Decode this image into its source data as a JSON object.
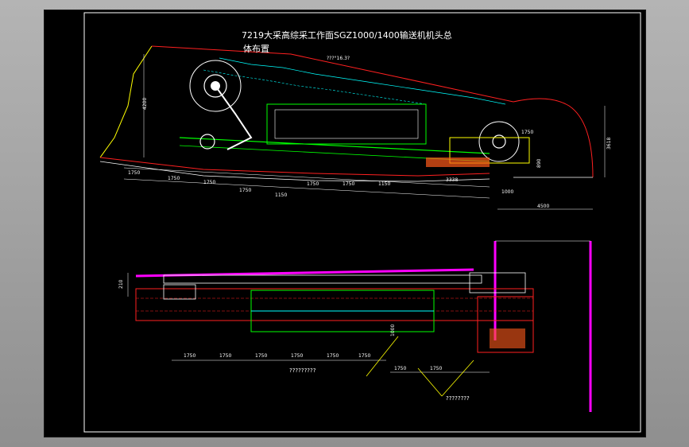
{
  "drawing": {
    "title": "7219大采高综采工作面SGZ1000/1400输送机机头总",
    "subtitle": "体布置",
    "section_dim": "???°16.3?",
    "height_dim_left": "4200",
    "height_dim_right": "3618",
    "width_dim_right": "4500",
    "dim_1000": "1000",
    "dim_1750_r": "1750",
    "dim_3338": "3338",
    "dim_890": "890",
    "side_dim_210": "210",
    "side_dim_1000": "1000",
    "callout_a": "?????????",
    "callout_b": "????????",
    "top_dims": [
      "1750",
      "1750",
      "1750",
      "1750",
      "1150",
      "1750",
      "1750",
      "1150"
    ],
    "bottom_dims": [
      "1750",
      "1750",
      "1750",
      "1750",
      "1750",
      "1750",
      "1750",
      "1750"
    ]
  },
  "colors": {
    "background": "#000000",
    "frame": "#ffffff",
    "green": "#00ff00",
    "cyan": "#00ffff",
    "red": "#ff2020",
    "yellow": "#ffff00",
    "magenta": "#ff00ff",
    "white": "#ffffff"
  }
}
